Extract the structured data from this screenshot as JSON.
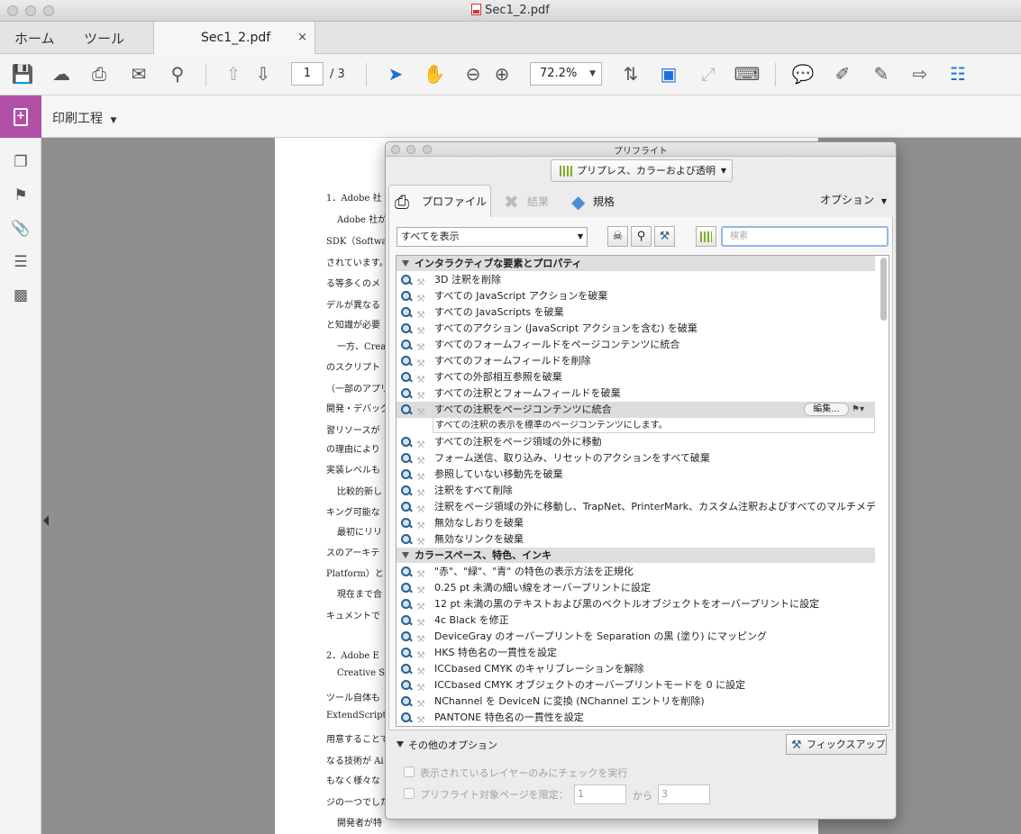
{
  "window": {
    "title": "Sec1_2.pdf"
  },
  "tabs": {
    "home": "ホーム",
    "tools": "ツール",
    "document": "Sec1_2.pdf",
    "close": "×"
  },
  "toolbar": {
    "page_current": "1",
    "page_total": "/ 3",
    "zoom": "72.2%"
  },
  "subbar": {
    "title": "印刷工程"
  },
  "document_page": {
    "lines": [
      "1．Adobe 社",
      "Adobe 社が",
      "SDK（Softwa",
      "されています。",
      "る等多くのメ",
      "デルが異なる",
      "と知識が必要",
      "一方、Creat",
      "のスクリプト",
      "（一部のアプリ",
      "開発・デバッグ",
      "習リソースが",
      "の理由により",
      "実装レベルも",
      "比較的新し",
      "キング可能な",
      "最初にリリ",
      "スのアーキテ",
      "Platform）と",
      "現在まで合",
      "キュメントで",
      "2．Adobe E",
      "Creative S",
      "ツール自体も",
      "ExtendScript",
      "用意することで",
      "なる技術が Ai",
      "もなく様々な",
      "ジの一つでした",
      "開発者が特"
    ]
  },
  "preflight": {
    "title": "プリフライト",
    "mode": "プリプレス、カラーおよび透明",
    "tab_profiles": "プロファイル",
    "tab_results": "結果",
    "tab_standards": "規格",
    "options": "オプション",
    "filter": "すべてを表示",
    "search_placeholder": "検索",
    "group1": "インタラクティブな要素とプロパティ",
    "group1_items": [
      "3D 注釈を削除",
      "すべての JavaScript アクションを破棄",
      "すべての JavaScripts を破棄",
      "すべてのアクション (JavaScript アクションを含む) を破棄",
      "すべてのフォームフィールドをページコンテンツに統合",
      "すべてのフォームフィールドを削除",
      "すべての外部相互参照を破棄",
      "すべての注釈とフォームフィールドを破棄",
      "すべての注釈をページコンテンツに統合"
    ],
    "edit_button": "編集...",
    "selected_description": "すべての注釈の表示を標準のページコンテンツにします。",
    "group1_items_after": [
      "すべての注釈をページ領域の外に移動",
      "フォーム送信、取り込み、リセットのアクションをすべて破棄",
      "参照していない移動先を破棄",
      "注釈をすべて削除",
      "注釈をページ領域の外に移動し、TrapNet、PrinterMark、カスタム注釈およびすべてのマルチメデ",
      "無効なしおりを破棄",
      "無効なリンクを破棄"
    ],
    "group2": "カラースペース、特色、インキ",
    "group2_items": [
      "\"赤\"、\"緑\"、\"青\" の特色の表示方法を正規化",
      "0.25 pt 未満の細い線をオーバープリントに設定",
      "12 pt 未満の黒のテキストおよび黒のベクトルオブジェクトをオーバープリントに設定",
      "4c Black を修正",
      "DeviceGray のオーバープリントを Separation の黒 (塗り) にマッピング",
      "HKS 特色名の一貫性を設定",
      "ICCbased CMYK のキャリブレーションを解除",
      "ICCbased CMYK オブジェクトのオーバープリントモードを 0 に設定",
      "NChannel を DeviceN に変換 (NChannel エントリを削除)",
      "PANTONE 特色名の一貫性を設定"
    ],
    "more_options": "その他のオプション",
    "fixup_button": "フィックスアップ",
    "opt_visible_layers": "表示されているレイヤーのみにチェックを実行",
    "opt_page_range": "プリフライト対象ページを限定：",
    "page_from": "1",
    "page_to_label": "から",
    "page_to": "3"
  }
}
